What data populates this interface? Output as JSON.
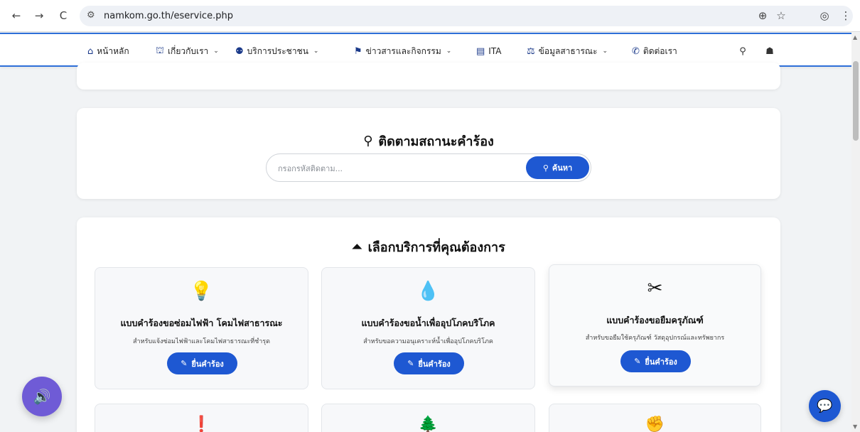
{
  "browser": {
    "url": "namkom.go.th/eservice.php",
    "back_icon": "←",
    "forward_icon": "→",
    "reload_icon": "C",
    "tune_icon": "⚙",
    "zoom_icon": "⊕",
    "star_icon": "☆",
    "profile_icon": "◎",
    "menu_icon": "⋮"
  },
  "nav": {
    "items": [
      {
        "icon": "⌂",
        "label": "หน้าหลัก",
        "chevron": ""
      },
      {
        "icon": "⛫",
        "label": "เกี่ยวกับเรา",
        "chevron": "⌄"
      },
      {
        "icon": "⚉",
        "label": "บริการประชาชน",
        "chevron": "⌄"
      },
      {
        "icon": "⚑",
        "label": "ข่าวสารและกิจกรรม",
        "chevron": "⌄"
      },
      {
        "icon": "▤",
        "label": "ITA",
        "chevron": ""
      },
      {
        "icon": "⚖",
        "label": "ข้อมูลสาธารณะ",
        "chevron": "⌄"
      },
      {
        "icon": "✆",
        "label": "ติดต่อเรา",
        "chevron": ""
      }
    ],
    "search_icon": "⚲",
    "sitemap_icon": "☗"
  },
  "tracking": {
    "title": "ติดตามสถานะคำร้อง",
    "icon": "⚲",
    "placeholder": "กรอกรหัสติดตาม...",
    "button_label": "ค้นหา",
    "button_icon": "⚲"
  },
  "services": {
    "title": "เลือกบริการที่คุณต้องการ",
    "title_icon": "⏶",
    "items": [
      {
        "icon": "💡",
        "name": "แบบคำร้องขอซ่อมไฟฟ้า โคมไฟสาธารณะ",
        "desc": "สำหรับแจ้งซ่อมไฟฟ้าและโคมไฟสาธารณะที่ชำรุด",
        "button": "ยื่นคำร้อง",
        "button_icon": "✎"
      },
      {
        "icon": "💧",
        "name": "แบบคำร้องขอน้ำเพื่ออุปโภคบริโภค",
        "desc": "สำหรับขอความอนุเคราะห์น้ำเพื่ออุปโภคบริโภค",
        "button": "ยื่นคำร้อง",
        "button_icon": "✎"
      },
      {
        "icon": "✂",
        "name": "แบบคำร้องขอยืมครุภัณฑ์",
        "desc": "สำหรับขอยืมใช้ครุภัณฑ์ วัสดุอุปกรณ์และทรัพยากร",
        "button": "ยื่นคำร้อง",
        "button_icon": "✎"
      }
    ],
    "next_icons": [
      "❗",
      "🌲",
      "✊"
    ]
  },
  "floating": {
    "speaker_icon": "🔊",
    "chat_icon": "💬"
  }
}
